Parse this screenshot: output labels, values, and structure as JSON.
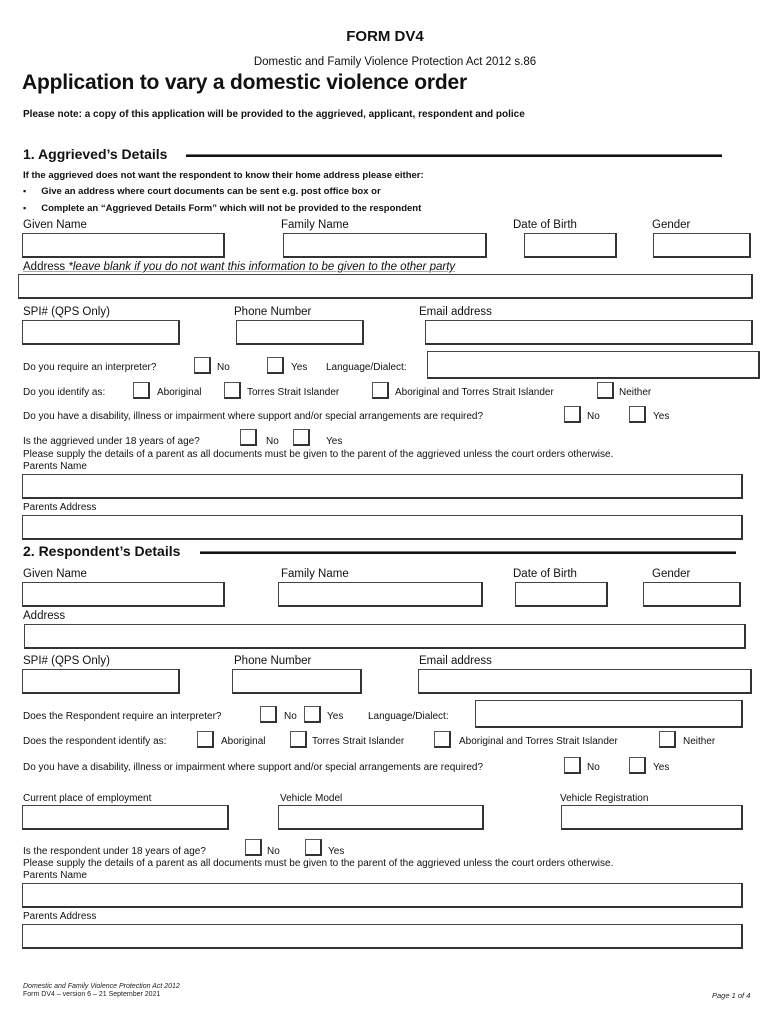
{
  "header": {
    "form_code": "FORM DV4",
    "act_reference": "Domestic and Family Violence Protection Act 2012 s.86",
    "title": "Application to vary a domestic violence order",
    "note": "Please note: a copy of this application will be provided to the aggrieved, applicant, respondent and police"
  },
  "aggrieved": {
    "heading": "1.  Aggrieved’s Details",
    "instructions": "If the aggrieved does not want the respondent to know their home address please either:",
    "bullets": [
      "Give an address where court documents can be sent e.g. post office box or",
      "Complete an “Aggrieved Details Form” which will not be provided to the respondent"
    ],
    "given_name_label": "Given Name",
    "family_name_label": "Family Name",
    "dob_label": "Date of Birth",
    "gender_label": "Gender",
    "address_label": "Address ",
    "address_hint": "*leave blank if you do not want this information to be given to the other party",
    "spi_label": "SPI# (QPS Only)",
    "phone_label": "Phone Number",
    "email_label": "Email address",
    "interpreter_q": "Do you require an interpreter?",
    "no": "No",
    "yes": "Yes",
    "language_label": "Language/Dialect:",
    "identify_q": "Do you identify as:",
    "identify_options": [
      "Aboriginal",
      "Torres Strait Islander",
      "Aboriginal and Torres Strait Islander",
      "Neither"
    ],
    "disability_q": "Do you have a disability, illness or impairment where support and/or special arrangements are required?",
    "under18_q": "Is the aggrieved under 18 years of age?",
    "parent_note": "Please supply the details of a parent as all documents must be given to the parent of the aggrieved unless the court orders otherwise.",
    "parents_name_label": "Parents Name",
    "parents_address_label": "Parents Address"
  },
  "respondent": {
    "heading": "2.  Respondent’s Details",
    "given_name_label": "Given Name",
    "family_name_label": "Family Name",
    "dob_label": "Date of Birth",
    "gender_label": "Gender",
    "address_label": "Address",
    "spi_label": "SPI# (QPS Only)",
    "phone_label": "Phone Number",
    "email_label": "Email address",
    "interpreter_q": "Does the Respondent require an interpreter?",
    "no": "No",
    "yes": "Yes",
    "language_label": "Language/Dialect:",
    "identify_q": "Does the respondent identify as:",
    "identify_options": [
      "Aboriginal",
      "Torres Strait Islander",
      "Aboriginal and Torres Strait Islander",
      "Neither"
    ],
    "disability_q": "Do you have a disability, illness or impairment where support and/or special arrangements are required?",
    "employment_label": "Current place of employment",
    "vehicle_model_label": "Vehicle Model",
    "vehicle_rego_label": "Vehicle Registration",
    "under18_q": "Is the respondent under 18 years of age?",
    "parent_note": "Please supply the details of a parent as all documents must be given to the parent of the aggrieved unless the court orders otherwise.",
    "parents_name_label": "Parents Name",
    "parents_address_label": "Parents Address"
  },
  "footer": {
    "act": "Domestic and Family Violence Protection Act 2012",
    "version": "Form DV4 – version 6 –  21 September 2021",
    "page": "Page 1 of 4"
  }
}
